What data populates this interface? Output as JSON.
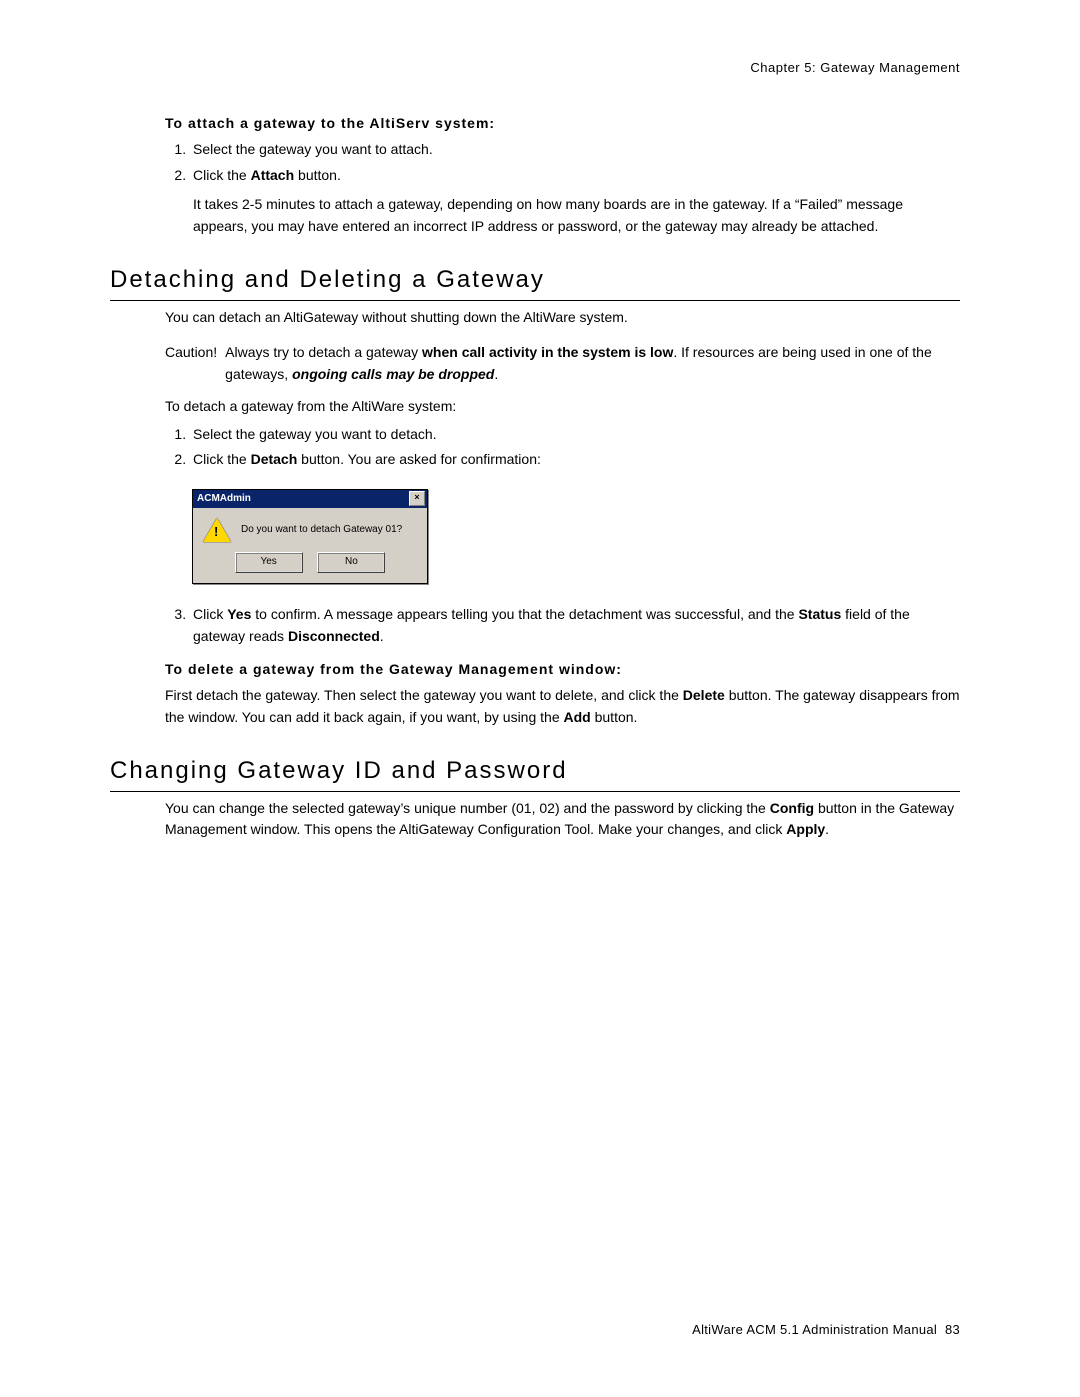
{
  "header": {
    "chapter": "Chapter 5:  Gateway Management"
  },
  "attach": {
    "heading": "To attach a gateway to the AltiServ system:",
    "step1": "Select the gateway you want to attach.",
    "step2_pre": "Click the ",
    "step2_btn": "Attach",
    "step2_post": " button.",
    "note": "It takes 2-5 minutes to attach a gateway, depending on how many boards are in the gateway. If a “Failed” message appears, you may have entered an incorrect IP address or password, or the gateway may already be attached."
  },
  "detach": {
    "h2": "Detaching and Deleting a Gateway",
    "intro": "You can detach an AltiGateway without shutting down the AltiWare system.",
    "caution_label": "Caution!",
    "caution_a": "Always try to detach a gateway ",
    "caution_b": "when call activity in the system is low",
    "caution_c": ". If resources are being used in one of the gateways, ",
    "caution_d": "ongoing calls may be dropped",
    "caution_e": ".",
    "pre_list": "To detach a gateway from the AltiWare system:",
    "step1": "Select the gateway you want to detach.",
    "step2_pre": "Click the ",
    "step2_btn": "Detach",
    "step2_post": " button. You are asked for confirmation:",
    "dialog": {
      "title": "ACMAdmin",
      "message": "Do you want to detach Gateway 01?",
      "yes": "Yes",
      "no": "No"
    },
    "step3_a": "Click ",
    "step3_b": "Yes",
    "step3_c": " to confirm. A message appears telling you that the detachment was successful, and the ",
    "step3_d": "Status",
    "step3_e": " field of the gateway reads ",
    "step3_f": "Disconnected",
    "step3_g": "."
  },
  "delete": {
    "heading": "To delete a gateway from the Gateway Management window:",
    "a": "First detach the gateway. Then select the gateway you want to delete, and click the ",
    "b": "Delete",
    "c": " button. The gateway disappears from the window. You can add it back again, if you want, by using the ",
    "d": "Add",
    "e": " button."
  },
  "change": {
    "h2": "Changing Gateway ID and Password",
    "a": "You can change the selected gateway’s unique number (01, 02) and the password by clicking the ",
    "b": "Config",
    "c": " button in the Gateway Management window. This opens the AltiGateway Configuration Tool. Make your changes, and click ",
    "d": "Apply",
    "e": "."
  },
  "footer": {
    "left": "AltiWare ACM 5.1 Administration Manual",
    "page": "83"
  }
}
